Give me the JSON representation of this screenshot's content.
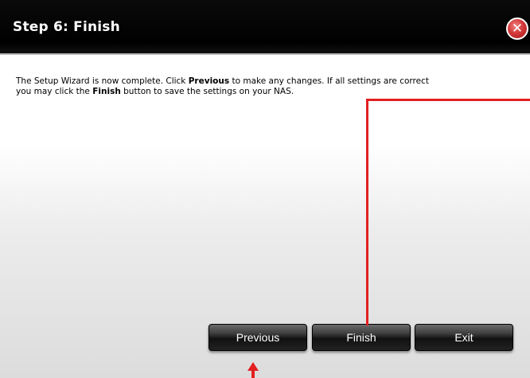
{
  "header": {
    "title": "Step 6: Finish",
    "close_icon": "close-icon"
  },
  "message": {
    "line1_pre": "The Setup Wizard is now complete. Click ",
    "line1_bold": "Previous",
    "line1_post": " to make any changes. If all settings are correct",
    "line2_pre": "you may click the ",
    "line2_bold": "Finish",
    "line2_post": " button to save the settings on your NAS."
  },
  "buttons": {
    "previous": "Previous",
    "finish": "Finish",
    "exit": "Exit"
  },
  "colors": {
    "header_bg": "#000000",
    "annotation": "#e2201f",
    "close_button": "#d43a3a"
  }
}
